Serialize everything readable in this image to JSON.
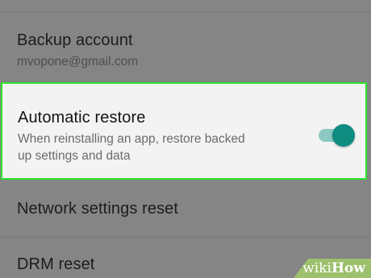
{
  "settings": {
    "backup_account": {
      "title": "Backup account",
      "value": "mvopone@gmail.com"
    },
    "automatic_restore": {
      "title": "Automatic restore",
      "description_line1": "When reinstalling an app, restore backed",
      "description_line2": "up settings and data",
      "toggle_on": true,
      "accent_color": "#0f8c80",
      "highlight_color": "#2ee12e"
    },
    "network_settings_reset": {
      "title": "Network settings reset"
    },
    "drm_reset": {
      "title": "DRM reset"
    }
  },
  "watermark": {
    "wiki": "wiki",
    "how": "How"
  }
}
